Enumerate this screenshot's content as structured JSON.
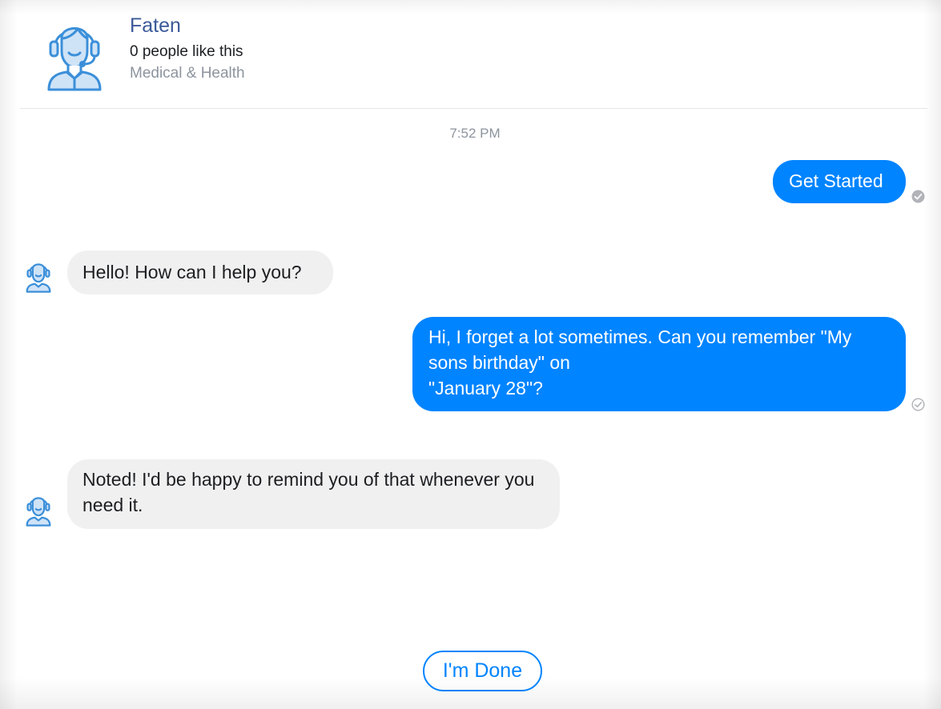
{
  "header": {
    "page_name": "Faten",
    "likes": "0 people like this",
    "category": "Medical & Health",
    "avatar_icon": "support-agent-icon"
  },
  "conversation": {
    "timestamp": "7:52 PM",
    "messages": [
      {
        "sender": "user",
        "text": "Get Started",
        "status_icon": "sent-check-icon"
      },
      {
        "sender": "bot",
        "text": "Hello! How can I help you?",
        "avatar_icon": "support-agent-icon"
      },
      {
        "sender": "user",
        "text": "Hi, I forget a lot sometimes. Can you remember \"My sons birthday\" on\n\"January 28\"?",
        "status_icon": "sent-check-icon"
      },
      {
        "sender": "bot",
        "text": "Noted! I'd be happy to remind you of that whenever you need it.",
        "avatar_icon": "support-agent-icon"
      }
    ]
  },
  "quick_reply": {
    "label": "I'm Done"
  },
  "colors": {
    "brand_blue": "#0084ff",
    "page_name_blue": "#3b5998",
    "incoming_bubble": "#f1f0f0",
    "muted_text": "#8d949e",
    "avatar_line": "#3b8fd9",
    "avatar_fill": "#cfe3f7"
  }
}
